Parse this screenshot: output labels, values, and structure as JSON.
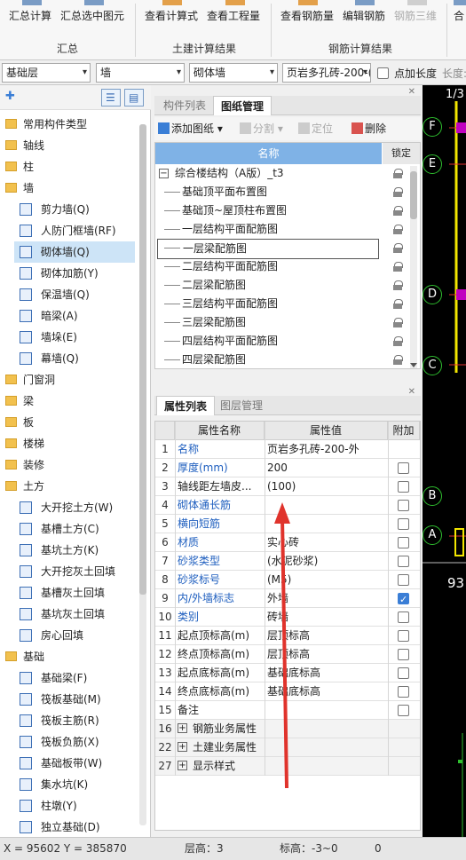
{
  "ribbon": {
    "buttons": [
      "汇总计算",
      "汇总选中图元",
      "查看计算式",
      "查看工程量",
      "查看钢筋量",
      "编辑钢筋",
      "钢筋三维",
      "合"
    ],
    "groups": [
      "汇总",
      "土建计算结果",
      "钢筋计算结果"
    ]
  },
  "toolbar": {
    "floor": "基础层",
    "category": "墙",
    "type": "砌体墙",
    "component": "页岩多孔砖-200-(",
    "dot_length_label": "点加长度",
    "length_label": "长度:"
  },
  "tree": [
    {
      "label": "常用构件类型",
      "level": 0
    },
    {
      "label": "轴线",
      "level": 0
    },
    {
      "label": "柱",
      "level": 0
    },
    {
      "label": "墙",
      "level": 0
    },
    {
      "label": "剪力墙(Q)",
      "level": 1
    },
    {
      "label": "人防门框墙(RF)",
      "level": 1
    },
    {
      "label": "砌体墙(Q)",
      "level": 1,
      "selected": true
    },
    {
      "label": "砌体加筋(Y)",
      "level": 1
    },
    {
      "label": "保温墙(Q)",
      "level": 1
    },
    {
      "label": "暗梁(A)",
      "level": 1
    },
    {
      "label": "墙垛(E)",
      "level": 1
    },
    {
      "label": "幕墙(Q)",
      "level": 1
    },
    {
      "label": "门窗洞",
      "level": 0
    },
    {
      "label": "梁",
      "level": 0
    },
    {
      "label": "板",
      "level": 0
    },
    {
      "label": "楼梯",
      "level": 0
    },
    {
      "label": "装修",
      "level": 0
    },
    {
      "label": "土方",
      "level": 0
    },
    {
      "label": "大开挖土方(W)",
      "level": 1
    },
    {
      "label": "基槽土方(C)",
      "level": 1
    },
    {
      "label": "基坑土方(K)",
      "level": 1
    },
    {
      "label": "大开挖灰土回填",
      "level": 1
    },
    {
      "label": "基槽灰土回填",
      "level": 1
    },
    {
      "label": "基坑灰土回填",
      "level": 1
    },
    {
      "label": "房心回填",
      "level": 1
    },
    {
      "label": "基础",
      "level": 0
    },
    {
      "label": "基础梁(F)",
      "level": 1
    },
    {
      "label": "筏板基础(M)",
      "level": 1
    },
    {
      "label": "筏板主筋(R)",
      "level": 1
    },
    {
      "label": "筏板负筋(X)",
      "level": 1
    },
    {
      "label": "基础板带(W)",
      "level": 1
    },
    {
      "label": "集水坑(K)",
      "level": 1
    },
    {
      "label": "柱墩(Y)",
      "level": 1
    },
    {
      "label": "独立基础(D)",
      "level": 1
    }
  ],
  "drawing_panel": {
    "tabs": [
      "构件列表",
      "图纸管理"
    ],
    "tools": {
      "add": "添加图纸",
      "split": "分割",
      "locate": "定位",
      "delete": "删除"
    },
    "col_name": "名称",
    "col_lock": "锁定",
    "root": "综合楼结构（A版）_t3",
    "rows": [
      "基础顶平面布置图",
      "基础顶~屋顶柱布置图",
      "一层结构平面配筋图",
      "一层梁配筋图",
      "二层结构平面配筋图",
      "二层梁配筋图",
      "三层结构平面配筋图",
      "三层梁配筋图",
      "四层结构平面配筋图",
      "四层梁配筋图"
    ]
  },
  "property_panel": {
    "tabs": [
      "属性列表",
      "图层管理"
    ],
    "headers": {
      "name": "属性名称",
      "value": "属性值",
      "extra": "附加"
    },
    "rows": [
      {
        "num": "1",
        "name": "名称",
        "value": "页岩多孔砖-200-外",
        "blue": true,
        "cb": "none"
      },
      {
        "num": "2",
        "name": "厚度(mm)",
        "value": "200",
        "blue": true,
        "cb": "off"
      },
      {
        "num": "3",
        "name": "轴线距左墙皮...",
        "value": "(100)",
        "blue": false,
        "cb": "off"
      },
      {
        "num": "4",
        "name": "砌体通长筋",
        "value": "",
        "blue": true,
        "cb": "off"
      },
      {
        "num": "5",
        "name": "横向短筋",
        "value": "",
        "blue": true,
        "cb": "off"
      },
      {
        "num": "6",
        "name": "材质",
        "value": "实心砖",
        "blue": true,
        "cb": "off"
      },
      {
        "num": "7",
        "name": "砂浆类型",
        "value": "(水泥砂浆)",
        "blue": true,
        "cb": "off"
      },
      {
        "num": "8",
        "name": "砂浆标号",
        "value": "(M5)",
        "blue": true,
        "cb": "off"
      },
      {
        "num": "9",
        "name": "内/外墙标志",
        "value": "外墙",
        "blue": true,
        "cb": "on"
      },
      {
        "num": "10",
        "name": "类别",
        "value": "砖墙",
        "blue": true,
        "cb": "off"
      },
      {
        "num": "11",
        "name": "起点顶标高(m)",
        "value": "层顶标高",
        "blue": false,
        "cb": "off"
      },
      {
        "num": "12",
        "name": "终点顶标高(m)",
        "value": "层顶标高",
        "blue": false,
        "cb": "off"
      },
      {
        "num": "13",
        "name": "起点底标高(m)",
        "value": "基础底标高",
        "blue": false,
        "cb": "off"
      },
      {
        "num": "14",
        "name": "终点底标高(m)",
        "value": "基础底标高",
        "blue": false,
        "cb": "off"
      },
      {
        "num": "15",
        "name": "备注",
        "value": "",
        "blue": false,
        "cb": "off"
      }
    ],
    "groups": [
      {
        "num": "16",
        "name": "钢筋业务属性"
      },
      {
        "num": "22",
        "name": "土建业务属性"
      },
      {
        "num": "27",
        "name": "显示样式"
      }
    ]
  },
  "cad": {
    "top_label": "1/3",
    "axes": [
      "F",
      "E",
      "D",
      "C",
      "B",
      "A"
    ],
    "dim": "93"
  },
  "status": {
    "coords": "X = 95602 Y = 385870",
    "floor_height": "层高：3",
    "elevation": "标高：-3~0",
    "zero": "0"
  },
  "colors": {
    "accent": "#3a7ed6",
    "grid_header": "#7fb2e6",
    "annotation_arrow": "#e0332c",
    "axis_green": "#2fbf2f"
  }
}
